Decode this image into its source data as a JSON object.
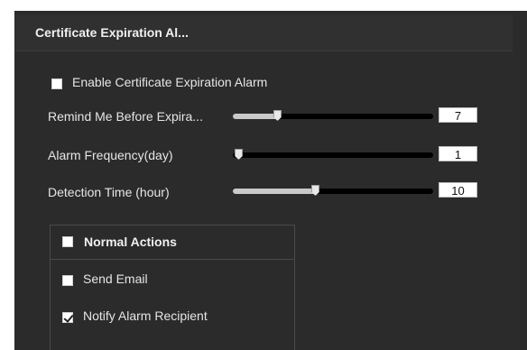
{
  "section": {
    "title": "Certificate Expiration Al..."
  },
  "enable_alarm": {
    "label": "Enable Certificate Expiration Alarm",
    "checked": false
  },
  "sliders": [
    {
      "label": "Remind Me Before Expira...",
      "value": "7",
      "fill_fraction": 0.22
    },
    {
      "label": "Alarm Frequency(day)",
      "value": "1",
      "fill_fraction": 0.0
    },
    {
      "label": "Detection Time (hour)",
      "value": "10",
      "fill_fraction": 0.41
    }
  ],
  "actions": {
    "header_label": "Normal Actions",
    "items": [
      {
        "label": "Send Email",
        "checked": false
      },
      {
        "label": "Notify Alarm Recipient",
        "checked": true
      }
    ]
  },
  "colors": {
    "panel_bg": "#2b2b2b",
    "text": "#e6e6e6",
    "track": "#000000",
    "fill": "#c9c9c9"
  }
}
